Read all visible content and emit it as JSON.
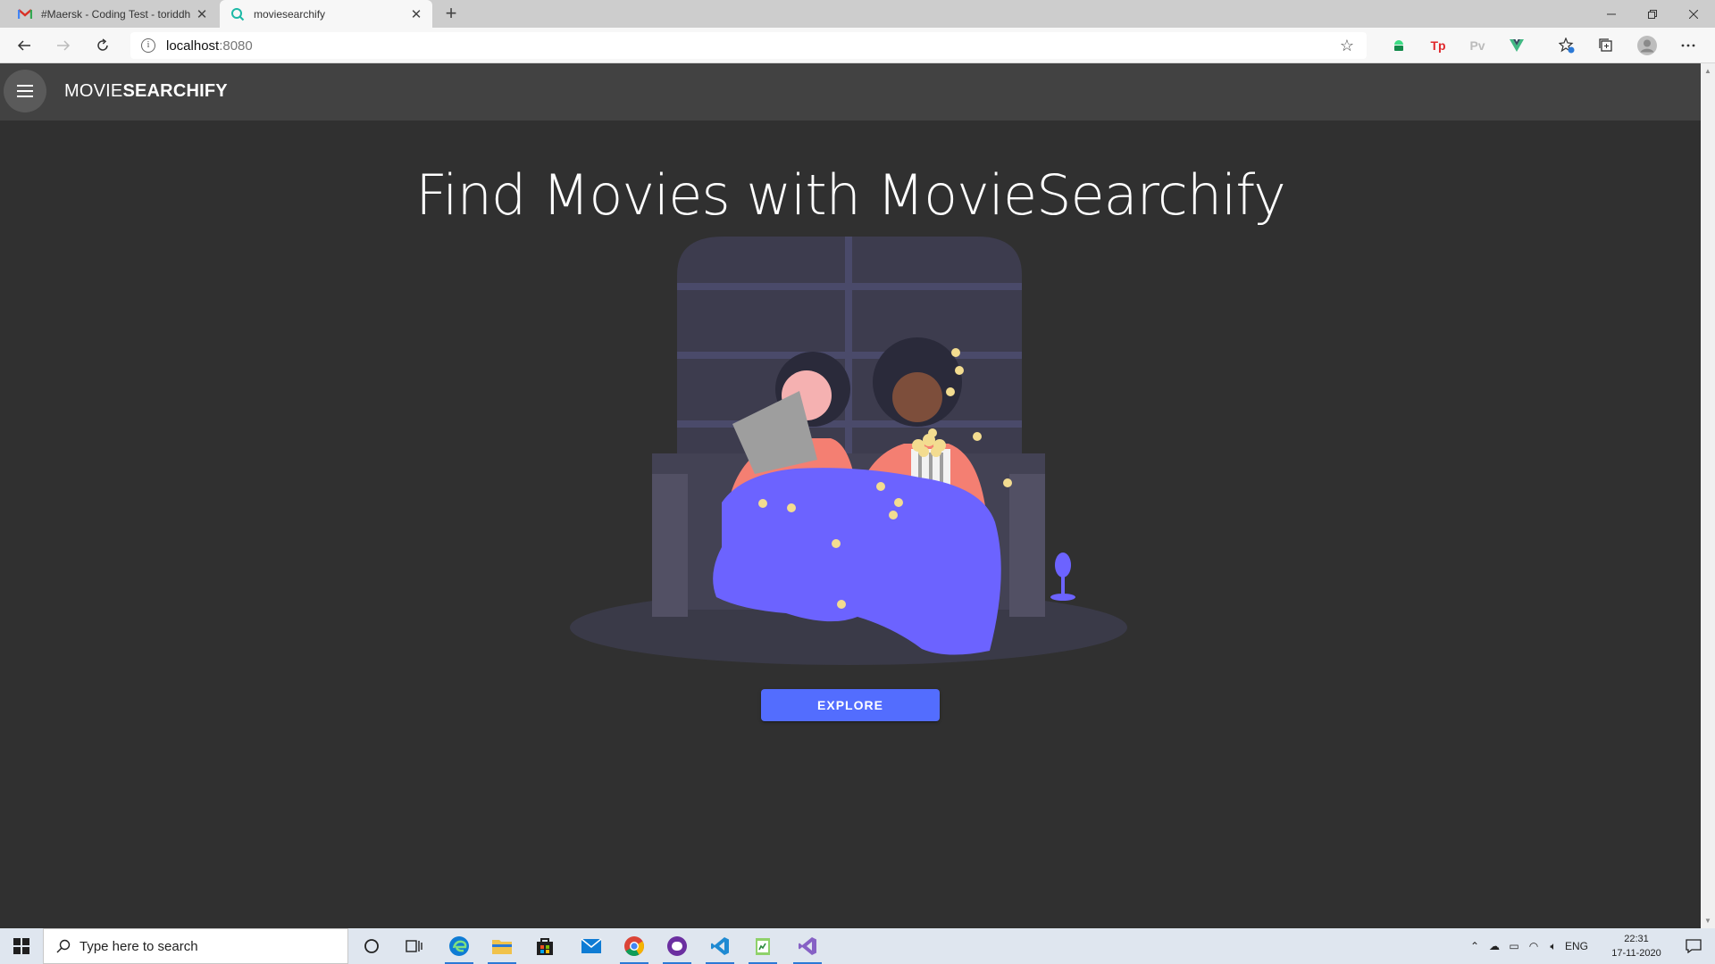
{
  "browser": {
    "tabs": [
      {
        "title": "#Maersk - Coding Test - toriddh",
        "active": false,
        "icon": "gmail-icon"
      },
      {
        "title": "moviesearchify",
        "active": true,
        "icon": "app-favicon"
      }
    ],
    "url_host": "localhost",
    "url_port": ":8080",
    "new_tab": "+",
    "extensions": [
      "android-ext-icon",
      "tp-ext-icon",
      "pv-ext-icon",
      "vue-ext-icon"
    ],
    "ext_labels": {
      "tp": "Tp",
      "pv": "Pv"
    }
  },
  "app": {
    "brand_light": "MOVIE",
    "brand_bold": "SEARCHIFY",
    "headline": "Find Movies with MovieSearchify",
    "explore_label": "EXPLORE",
    "accent_color": "#536dfe"
  },
  "taskbar": {
    "search_placeholder": "Type here to search",
    "language": "ENG",
    "time": "22:31",
    "date": "17-11-2020"
  }
}
